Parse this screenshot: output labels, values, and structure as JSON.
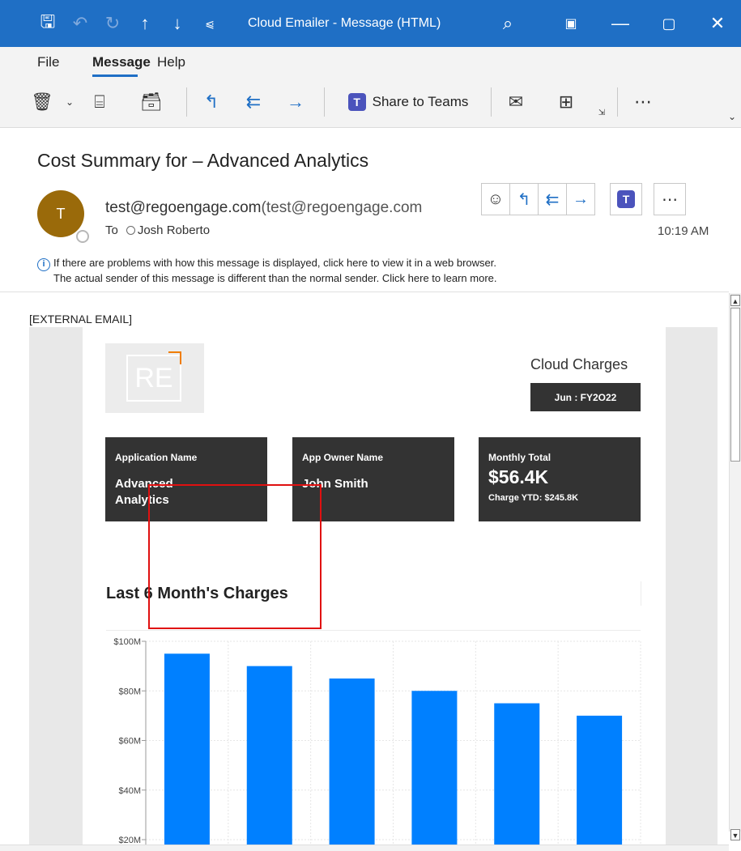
{
  "titlebar": {
    "title": "Cloud Emailer  -  Message (HTML)",
    "icons": [
      "save-icon",
      "undo-icon",
      "redo-icon",
      "up-arrow-icon",
      "down-arrow-icon",
      "customize-icon",
      "search-icon",
      "window-mode-icon"
    ],
    "controls": [
      "minimize-icon",
      "maximize-icon",
      "close-icon"
    ]
  },
  "menubar": {
    "items": [
      "File",
      "Message",
      "Help"
    ],
    "active": "Message"
  },
  "ribbon": {
    "share_label": "Share to Teams"
  },
  "message": {
    "subject": "Cost Summary for – Advanced Analytics",
    "avatar_initial": "T",
    "from_name": "test@regoengage.com",
    "from_address": "(test@regoengage.com",
    "to_label": "To",
    "to_recipient": "Josh Roberto",
    "time": "10:19 AM",
    "info_line_1": "If there are problems with how this message is displayed, click here to view it in a web browser.",
    "info_line_2": "The actual sender of this message is different than the normal sender. Click here to learn more.",
    "info_icon": "i"
  },
  "email_body": {
    "external_tag": "[EXTERNAL EMAIL]",
    "logo_text": "RE",
    "header_title": "Cloud Charges",
    "period": "Jun : FY2O22",
    "cards": {
      "app_label": "Application Name",
      "app_value_1": "Advanced",
      "app_value_2": "Analytics",
      "owner_label": "App Owner Name",
      "owner_value": "John Smith",
      "total_label": "Monthly Total",
      "total_value": "$56.4K",
      "ytd": "Charge YTD: $245.8K"
    },
    "chart_title": "Last 6 Month's Charges"
  },
  "colors": {
    "accent": "#1f6fc5",
    "bar": "#0080ff",
    "card": "#333333",
    "highlight": "#e01010",
    "avatar": "#9a6a0a"
  },
  "chart_data": {
    "type": "bar",
    "title": "Last 6 Month's Charges",
    "categories": [
      "",
      "",
      "",
      "",
      "",
      ""
    ],
    "values": [
      95,
      90,
      85,
      80,
      75,
      70
    ],
    "ylim": [
      20,
      100
    ],
    "ytick_labels": [
      "$100M",
      "$80M",
      "$60M",
      "$40M",
      "$20M"
    ],
    "ytick_values": [
      100,
      80,
      60,
      40,
      20
    ],
    "grid": true,
    "note_visible_range": "chart is cropped at bottom of the window"
  }
}
